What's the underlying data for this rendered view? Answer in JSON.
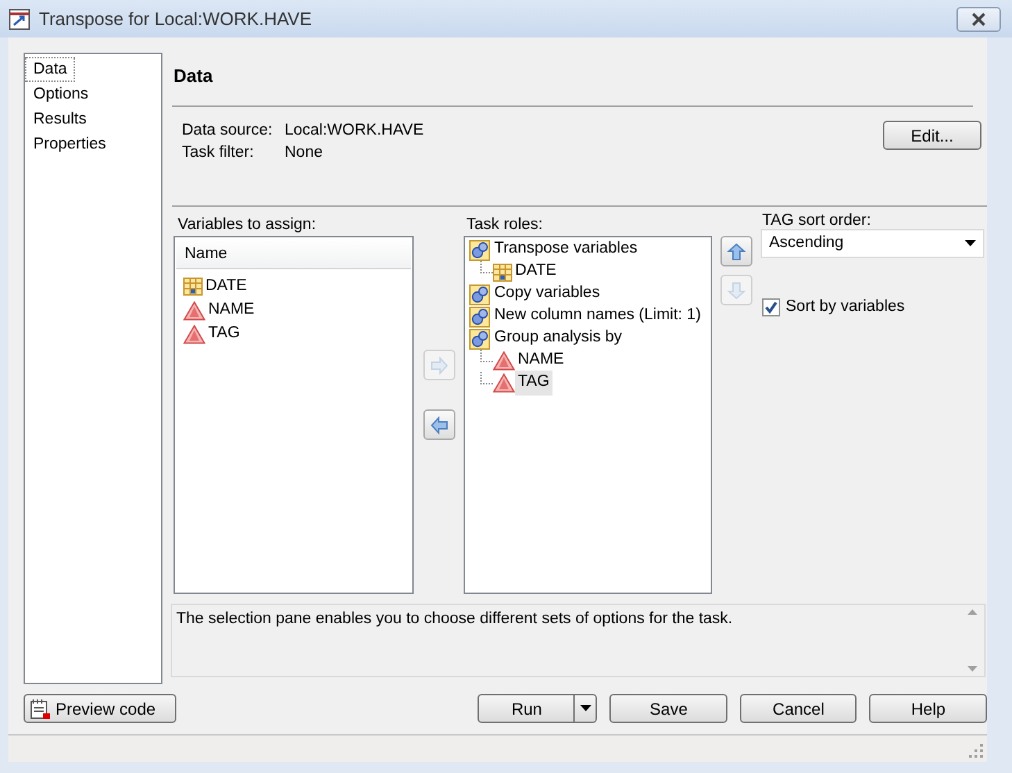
{
  "window": {
    "title": "Transpose for Local:WORK.HAVE"
  },
  "sidebar": {
    "items": [
      {
        "label": "Data",
        "selected": true
      },
      {
        "label": "Options",
        "selected": false
      },
      {
        "label": "Results",
        "selected": false
      },
      {
        "label": "Properties",
        "selected": false
      }
    ]
  },
  "page": {
    "heading": "Data"
  },
  "data_source": {
    "fields": [
      {
        "label": "Data source:",
        "value": "Local:WORK.HAVE"
      },
      {
        "label": "Task filter:",
        "value": "None"
      }
    ],
    "edit_button": "Edit..."
  },
  "variables": {
    "label": "Variables to assign:",
    "column": "Name",
    "items": [
      {
        "name": "DATE",
        "kind": "numeric"
      },
      {
        "name": "NAME",
        "kind": "character"
      },
      {
        "name": "TAG",
        "kind": "character"
      }
    ]
  },
  "move_buttons": [
    {
      "kind": "right",
      "disabled": true
    },
    {
      "kind": "left",
      "disabled": false
    }
  ],
  "task_roles": {
    "label": "Task roles:",
    "roles": [
      {
        "name": "Transpose variables",
        "children": [
          {
            "name": "DATE",
            "kind": "numeric",
            "selected": false
          }
        ]
      },
      {
        "name": "Copy variables"
      },
      {
        "name": "New column names  (Limit: 1)"
      },
      {
        "name": "Group analysis by",
        "children": [
          {
            "name": "NAME",
            "kind": "character",
            "selected": false
          },
          {
            "name": "TAG",
            "kind": "character",
            "selected": true
          }
        ]
      }
    ]
  },
  "order_buttons": [
    {
      "kind": "up",
      "disabled": false
    },
    {
      "kind": "down",
      "disabled": true
    }
  ],
  "sort_order": {
    "label": "TAG sort order:",
    "value": "Ascending"
  },
  "sort_by": {
    "label": "Sort by variables",
    "checked": true
  },
  "help_text": "The selection pane enables you to choose different sets of options for the task.",
  "preview_button": "Preview code",
  "buttons": [
    {
      "label": "Run",
      "kind": "split"
    },
    {
      "label": "Save",
      "kind": "plain"
    },
    {
      "label": "Cancel",
      "kind": "plain"
    },
    {
      "label": "Help",
      "kind": "plain"
    }
  ]
}
